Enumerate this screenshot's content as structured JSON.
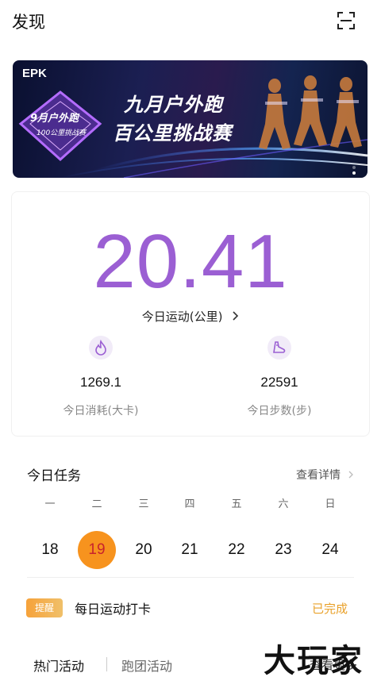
{
  "header": {
    "title": "发现",
    "scan_icon": "scan-icon"
  },
  "banner": {
    "brand": "EPK",
    "headline_line1": "九月户外跑",
    "headline_line2": "百公里挑战赛",
    "badge_text": "9月户外跑",
    "badge_sub": "100公里挑战赛",
    "indicator_count": 2,
    "indicator_active": 2
  },
  "stats": {
    "distance_value": "20.41",
    "distance_label": "今日运动(公里)",
    "calories_value": "1269.1",
    "calories_label": "今日消耗(大卡)",
    "steps_value": "22591",
    "steps_label": "今日步数(步)",
    "calories_icon": "flame-icon",
    "steps_icon": "shoe-icon"
  },
  "tasks": {
    "title": "今日任务",
    "more_label": "查看详情",
    "weekdays": [
      "一",
      "二",
      "三",
      "四",
      "五",
      "六",
      "日"
    ],
    "days": [
      "18",
      "19",
      "20",
      "21",
      "22",
      "23",
      "24"
    ],
    "selected_day": "19"
  },
  "checkin": {
    "badge": "提醒",
    "label": "每日运动打卡",
    "status": "已完成"
  },
  "activity_tabs": {
    "hot": "热门活动",
    "club": "跑团活动",
    "more": "查看更多"
  },
  "watermark": "大玩家",
  "colors": {
    "accent_purple": "#9b5fd3",
    "orange": "#f7931e",
    "done_orange": "#e9a12a"
  }
}
